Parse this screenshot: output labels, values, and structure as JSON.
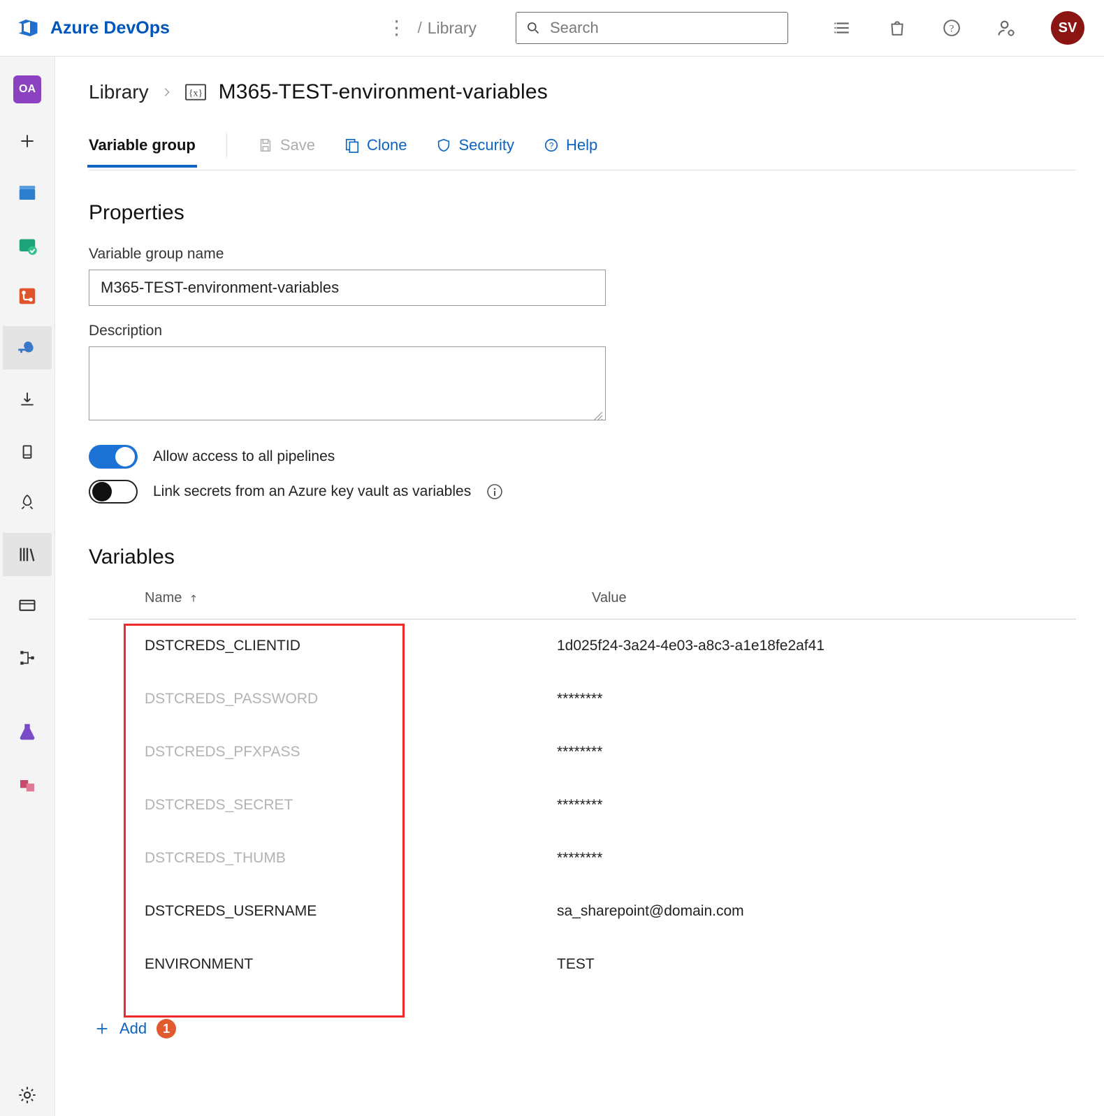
{
  "header": {
    "brand": "Azure DevOps",
    "breadcrumb_project": "Library",
    "search_placeholder": "Search",
    "avatar_initials": "SV"
  },
  "left_rail": {
    "project_initials": "OA"
  },
  "breadcrumb": {
    "parent": "Library",
    "current": "M365-TEST-environment-variables"
  },
  "tabs": {
    "variable_group": "Variable group",
    "save": "Save",
    "clone": "Clone",
    "security": "Security",
    "help": "Help"
  },
  "properties": {
    "heading": "Properties",
    "name_label": "Variable group name",
    "name_value": "M365-TEST-environment-variables",
    "description_label": "Description",
    "description_value": "",
    "toggle_allow_access": "Allow access to all pipelines",
    "toggle_link_keyvault": "Link secrets from an Azure key vault as variables"
  },
  "variables": {
    "heading": "Variables",
    "col_name": "Name",
    "col_value": "Value",
    "rows": [
      {
        "name": "DSTCREDS_CLIENTID",
        "value": "1d025f24-3a24-4e03-a8c3-a1e18fe2af41",
        "secret": false
      },
      {
        "name": "DSTCREDS_PASSWORD",
        "value": "********",
        "secret": true
      },
      {
        "name": "DSTCREDS_PFXPASS",
        "value": "********",
        "secret": true
      },
      {
        "name": "DSTCREDS_SECRET",
        "value": "********",
        "secret": true
      },
      {
        "name": "DSTCREDS_THUMB",
        "value": "********",
        "secret": true
      },
      {
        "name": "DSTCREDS_USERNAME",
        "value": "sa_sharepoint@domain.com",
        "secret": false
      },
      {
        "name": "ENVIRONMENT",
        "value": "TEST",
        "secret": false
      }
    ],
    "add_label": "Add",
    "annotation_badge": "1"
  }
}
